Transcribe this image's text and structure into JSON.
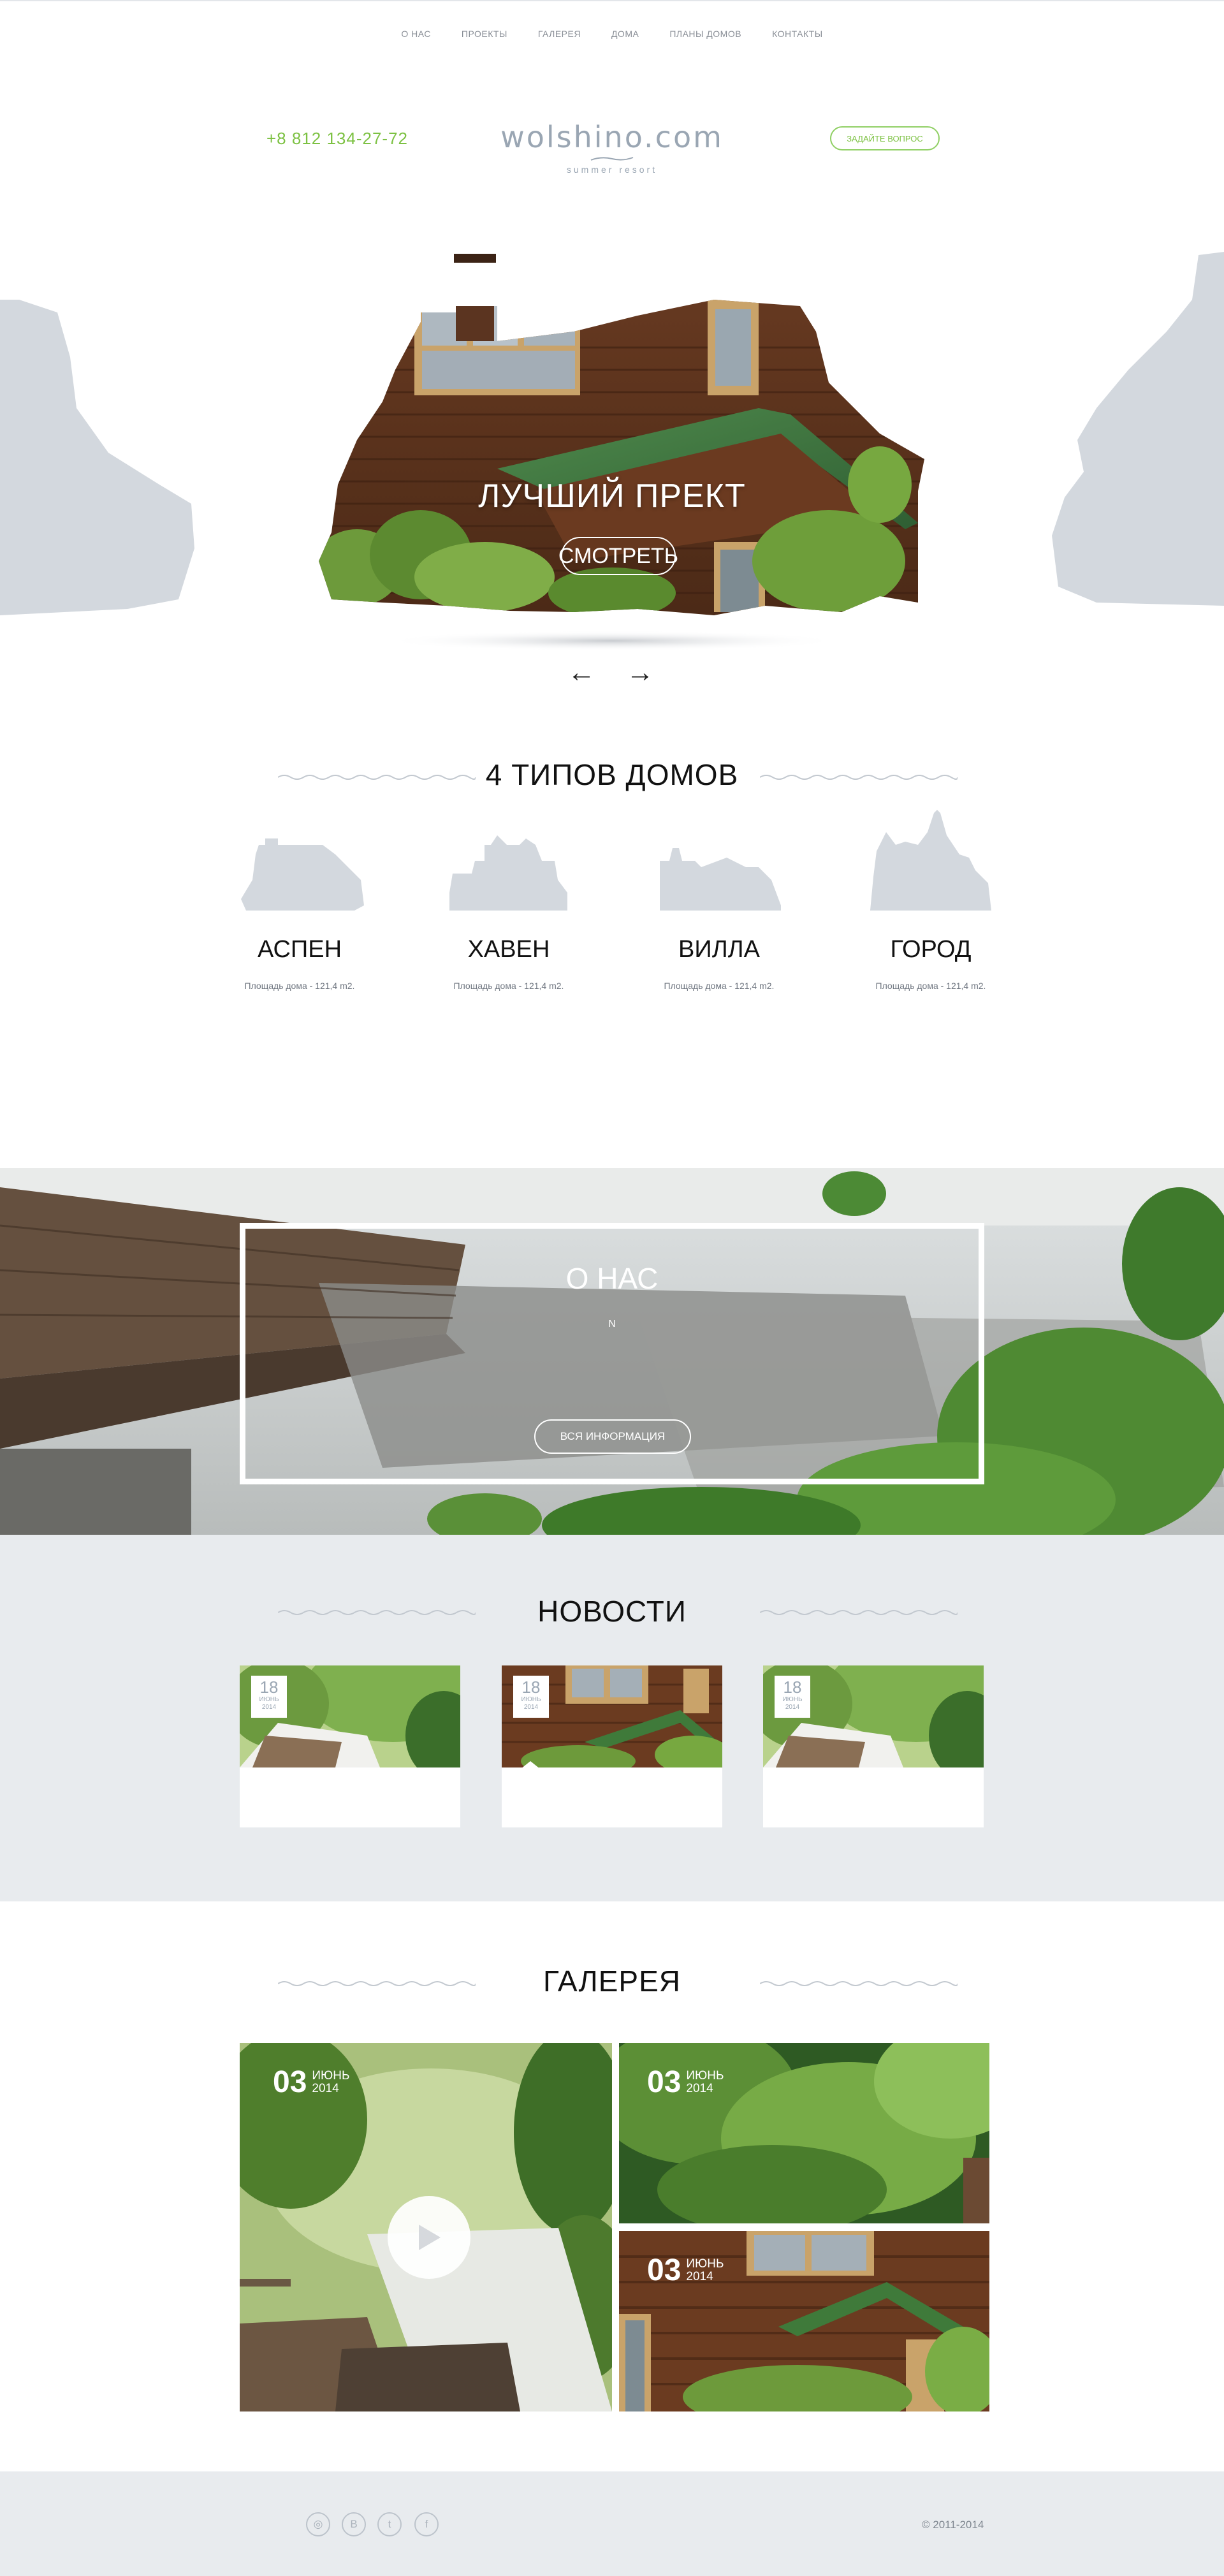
{
  "nav": {
    "items": [
      "О НАС",
      "ПРОЕКТЫ",
      "ГАЛЕРЕЯ",
      "ДОМА",
      "ПЛАНЫ ДОМОВ",
      "КОНТАКТЫ"
    ]
  },
  "header": {
    "phone": "+8 812 134-27-72",
    "logo": "wolshino.com",
    "tagline": "summer resort",
    "ask_button": "ЗАДАЙТЕ ВОПРОС"
  },
  "hero": {
    "title": "ЛУЧШИЙ ПРЕКТ",
    "button": "СМОТРЕТЬ",
    "prev_arrow": "←",
    "next_arrow": "→"
  },
  "types": {
    "title": "4 ТИПОВ ДОМОВ",
    "items": [
      {
        "name": "АСПЕН",
        "area": "Площадь дома - 121,4 m2.",
        "icon": "house-silhouette-icon"
      },
      {
        "name": "ХАВЕН",
        "area": "Площадь дома - 121,4 m2.",
        "icon": "house-silhouette-icon"
      },
      {
        "name": "ВИЛЛА",
        "area": "Площадь дома - 121,4 m2.",
        "icon": "house-silhouette-icon"
      },
      {
        "name": "ГОРОД",
        "area": "Площадь дома - 121,4 m2.",
        "icon": "house-silhouette-icon"
      }
    ]
  },
  "about": {
    "title": "О НАС",
    "text": "N",
    "button": "ВСЯ ИНФОРМАЦИЯ"
  },
  "news": {
    "title": "НОВОСТИ",
    "items": [
      {
        "day": "18",
        "month": "ИЮНЬ",
        "year": "2014"
      },
      {
        "day": "18",
        "month": "ИЮНЬ",
        "year": "2014"
      },
      {
        "day": "18",
        "month": "ИЮНЬ",
        "year": "2014"
      }
    ]
  },
  "gallery": {
    "title": "ГАЛЕРЕЯ",
    "items": [
      {
        "day": "03",
        "month": "ИЮНЬ",
        "year": "2014"
      },
      {
        "day": "03",
        "month": "ИЮНЬ",
        "year": "2014"
      },
      {
        "day": "03",
        "month": "ИЮНЬ",
        "year": "2014"
      }
    ]
  },
  "footer": {
    "social": [
      {
        "icon": "instagram-icon",
        "glyph": "◎"
      },
      {
        "icon": "vk-icon",
        "glyph": "B"
      },
      {
        "icon": "twitter-icon",
        "glyph": "t"
      },
      {
        "icon": "facebook-icon",
        "glyph": "f"
      }
    ],
    "copyright": "© 2011-2014"
  },
  "colors": {
    "accent_green": "#7cc142",
    "logo_grey": "#9aa6b3",
    "light_bg": "#e8ebee",
    "silhouette": "#d3d8de"
  }
}
